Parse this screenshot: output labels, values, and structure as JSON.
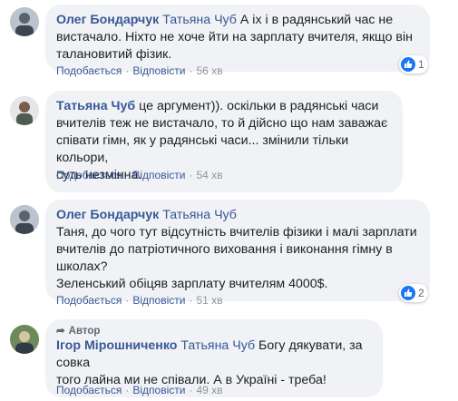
{
  "comments": [
    {
      "author": "Олег Бондарчук",
      "mention": "Татьяна Чуб",
      "lines": [
        "А іх і в радянський час не",
        "вистачало. Ніхто не хоче йти на зарплату вчителя, якщо він",
        "талановитий фізик."
      ],
      "like": "Подобається",
      "reply": "Відповісти",
      "time": "56 хв",
      "reaction_count": "1"
    },
    {
      "author": "Татьяна Чуб",
      "lines": [
        "це аргумент)). оскільки в радянські часи",
        "вчителів теж не вистачало, то й дійсно що нам заважає",
        "співати гімн, як у радянські часи... змінили тільки кольори,",
        "суть незмінна."
      ],
      "like": "Подобається",
      "reply": "Відповісти",
      "time": "54 хв"
    },
    {
      "author": "Олег Бондарчук",
      "mention": "Татьяна Чуб",
      "lines": [
        "Таня, до чого тут відсутність вчителів фізики і малі зарплати",
        "вчителів до патріотичного виховання і виконання гімну в",
        "школах?",
        "Зеленський обіцяв зарплату вчителям 4000$."
      ],
      "like": "Подобається",
      "reply": "Відповісти",
      "time": "51 хв",
      "reaction_count": "2"
    },
    {
      "tag": "Автор",
      "author": "Ігор Мірошниченко",
      "mention": "Татьяна Чуб",
      "lines": [
        "Богу дякувати, за совка",
        "того лайна ми не співали. А в Україні - треба!"
      ],
      "like": "Подобається",
      "reply": "Відповісти",
      "time": "49 хв"
    }
  ],
  "separator": "·",
  "colors": {
    "link": "#385898",
    "bubble": "#f0f2f5",
    "meta": "#90949c",
    "like_blue": "#1877f2"
  }
}
